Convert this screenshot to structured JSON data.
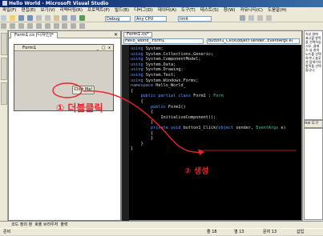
{
  "window": {
    "title": "Hello World - Microsoft Visual Studio"
  },
  "menu": [
    "파일(F)",
    "편집(E)",
    "보기(V)",
    "리팩터링(R)",
    "프로젝트(P)",
    "빌드(B)",
    "디버그(D)",
    "데이터(A)",
    "도구(T)",
    "테스트(S)",
    "창(W)",
    "커뮤니티(C)",
    "도움말(H)"
  ],
  "toolbar": {
    "config": "Debug",
    "platform": "Any CPU",
    "find": "limit"
  },
  "designer": {
    "tab_label": "Form1.cs [디자인]*",
    "close_glyph": "✕",
    "form_title": "Form1",
    "form_buttons": "_ □ x",
    "button_text": "Click Me!"
  },
  "code": {
    "tab_label": "Form1.cs*",
    "class_combo": "Hello_World_.Form1",
    "member_combo": "button1_Click(object sender, EventArgs e)",
    "lines": [
      "using System;",
      "using System.Collections.Generic;",
      "using System.ComponentModel;",
      "using System.Data;",
      "using System.Drawing;",
      "using System.Text;",
      "using System.Windows.Forms;",
      "",
      "namespace Hello_World_",
      "{",
      "    public partial class Form1 : Form",
      "    {",
      "        public Form1()",
      "        {",
      "            InitializeComponent();",
      "        }",
      "",
      "        private void button1_Click(object sender, EventArgs e)",
      "        {",
      "",
      "        }",
      "    }",
      "}"
    ]
  },
  "right_panel": {
    "text": "속성 창에 표시할 항목을 선택하십시오. 클래스 뷰 창의 노드를 선택하거나 솔루션 탐색기의 항목을 선택합니다.",
    "tab1": "Hel",
    "tab2": "도구"
  },
  "bottom_tabs": [
    "코드 정의 창",
    "호출 브라우저",
    "출력"
  ],
  "status": {
    "ready": "준비",
    "line": "줄 18",
    "col": "열 13",
    "ch": "문자 13",
    "ins": "삽입"
  },
  "annotations": {
    "step1": "① 더블클릭",
    "step2": "② 생성"
  },
  "colors": {
    "annotation": "#e8242a",
    "code_bg": "#000000",
    "titlebar": "#0a246a"
  }
}
